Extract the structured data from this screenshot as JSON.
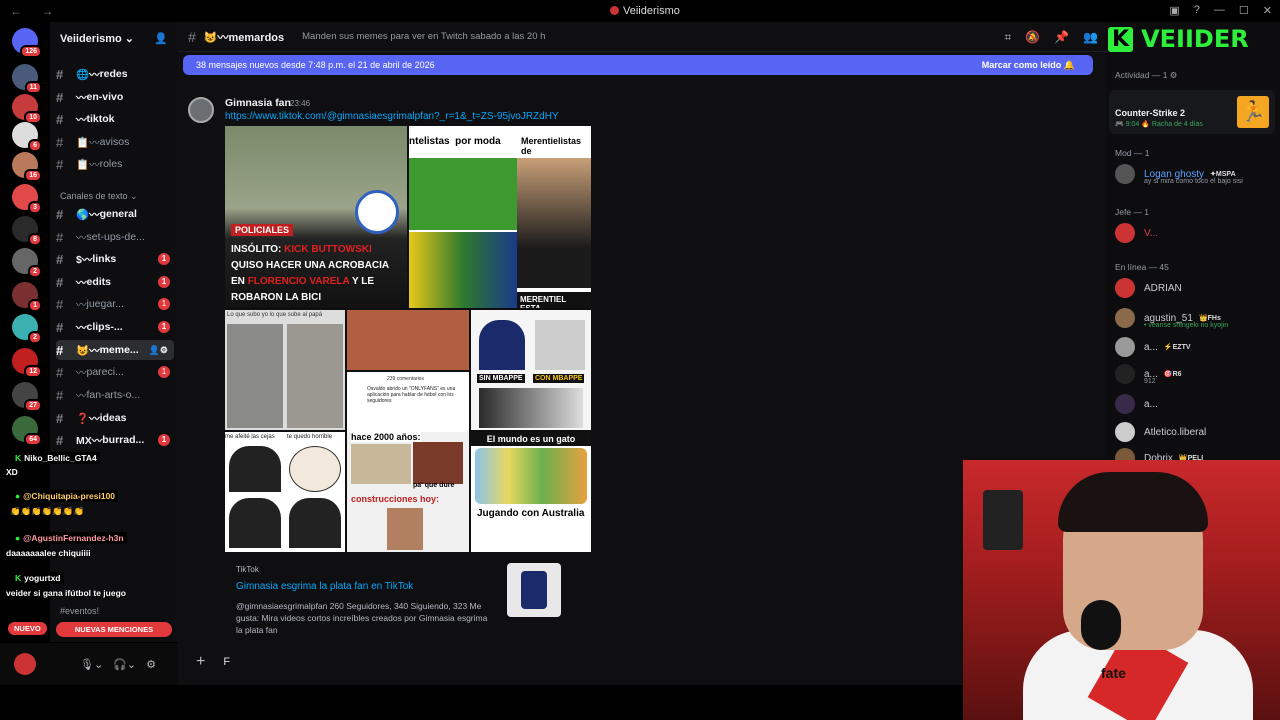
{
  "window": {
    "title": "Veiiderismo",
    "nav": "← →"
  },
  "guild": {
    "name": "Veiiderismo ⌄"
  },
  "channels": [
    {
      "label": "redes",
      "prefix": "🌐〰",
      "state": "bright",
      "top": 0,
      "mention": ""
    },
    {
      "label": "en-vivo",
      "prefix": "〰",
      "state": "bright",
      "mention": ""
    },
    {
      "label": "tiktok",
      "prefix": "〰",
      "state": "bright",
      "mention": ""
    },
    {
      "label": "avisos",
      "prefix": "📋〰",
      "state": "dim",
      "mention": ""
    },
    {
      "label": "roles",
      "prefix": "📋〰",
      "state": "dim",
      "mention": ""
    }
  ],
  "category_text": "Canales de texto ⌄",
  "channels2": [
    {
      "label": "general",
      "prefix": "🌎〰",
      "state": "bright",
      "mention": ""
    },
    {
      "label": "set-ups-de...",
      "prefix": "〰",
      "state": "dim",
      "mention": ""
    },
    {
      "label": "links",
      "prefix": "$〰",
      "state": "bright",
      "mention": "1"
    },
    {
      "label": "edits",
      "prefix": "〰",
      "state": "bright",
      "mention": "1"
    },
    {
      "label": "juegar...",
      "prefix": "〰",
      "state": "dim",
      "mention": "1"
    },
    {
      "label": "clips-...",
      "prefix": "〰",
      "state": "bright",
      "mention": "1"
    },
    {
      "label": "memе...",
      "prefix": "😺〰",
      "state": "active",
      "mention": ""
    },
    {
      "label": "pareci...",
      "prefix": "〰",
      "state": "dim",
      "mention": "1"
    },
    {
      "label": "fan-arts-o...",
      "prefix": "〰",
      "state": "dim",
      "mention": ""
    },
    {
      "label": "ideas",
      "prefix": "❓〰",
      "state": "bright",
      "mention": ""
    },
    {
      "label": "burrad...",
      "prefix": "MX〰",
      "state": "bright",
      "mention": "1"
    }
  ],
  "events_cat": "#eventos!",
  "nuevo": "NUEVO",
  "nuevas": "NUEVAS MENCIONES",
  "server_badges": [
    "126",
    "11",
    "10",
    "6",
    "16",
    "3",
    "8",
    "2",
    "1",
    "2",
    "12",
    "27",
    "64"
  ],
  "header": {
    "name": "😺〰memardos",
    "topic": "Manden sus memes para ver en Twitch sabado a las 20 h"
  },
  "newbar": {
    "text": "38 mensajes nuevos desde 7:48 p.m. el 21 de abril de 2026",
    "action": "Marcar como leído"
  },
  "message": {
    "user": "Gimnasia fan",
    "time": "23:46",
    "link": "https://www.tiktok.com/@gimnasiaesgrimalpfan?_r=1&_t=ZS-95jvoJRZdHY"
  },
  "memes": {
    "m1_tag": "POLICIALES",
    "m1_l1": "INSÓLITO:",
    "m1_l1b": "KICK BUTTOWSKI",
    "m1_l2": "QUISO HACER UNA ACROBACIA",
    "m1_l3a": "EN",
    "m1_l3b": "FLORENCIO VARELA",
    "m1_l3c": "Y LE",
    "m1_l4": "ROBARON LA BICI",
    "m2_top": "ntelistas",
    "m2_top2": "por moda",
    "m3_top": "Merentielistas",
    "m3_top2": "de",
    "m3_bottom": "MERENTIEL ESTA",
    "m4_top": "Lo que subo yo     lo que sube al papá",
    "m6_text": "Osvaldo abrido un \"ONLYFANS\" es una aplicación para hablar de futbol con los seguidores",
    "m6_head": "239 comentarios",
    "m7_l": "SIN MBAPPE",
    "m7_r": "CON MBAPPE",
    "m8_top": "me afeité las cejas",
    "m8_top2": "te quedo horrible",
    "m9_top": "hace 2000 años:",
    "m9_mid": "pa' que dure",
    "m9_bot": "construcciones hoy:",
    "m10_top": "El mundo es un gato",
    "m10_bot": "Jugando con Australia"
  },
  "embed": {
    "source": "TikTok",
    "title": "Gimnasia esgrima la plata fan en TikTok",
    "desc": "@gimnasiaesgrimalpfan 260 Seguidores, 340 Siguiendo, 323 Me gusta: Mira videos cortos increíbles creados por Gimnasia esgrima la plata fan"
  },
  "composer": {
    "text": "F"
  },
  "logo": {
    "k": "K",
    "text": "VEIIDER"
  },
  "members": {
    "activity": "Actividad — 1 ⚙",
    "game": "Counter-Strike 2",
    "game_meta": "🎮 9:04  🔥 Racha de 4 días",
    "mod": "Mod — 1",
    "mod_name": "Logan ghosty",
    "mod_tag": "✦MSPA",
    "mod_sub": "ay si mira como toco el bajo sisi",
    "jefe": "Jefe — 1",
    "jefe_name": "V...",
    "online": "En línea — 45",
    "list": [
      {
        "name": "ADRIAN",
        "tag": "",
        "sub": ""
      },
      {
        "name": "agustin_51",
        "tag": "👑FHs",
        "sub": "• veanse shingeki no kyojin"
      },
      {
        "name": "a...",
        "tag": "⚡EZTV",
        "sub": ""
      },
      {
        "name": "a...",
        "tag": "🎯R6",
        "sub": "912"
      },
      {
        "name": "a...",
        "tag": "",
        "sub": ""
      },
      {
        "name": "Atletico.liberal",
        "tag": "",
        "sub": ""
      },
      {
        "name": "Dobrix",
        "tag": "👑PELI",
        "sub": ""
      }
    ]
  },
  "chat": [
    {
      "name": "Niko_Bellic_GTA4",
      "text": "XD"
    },
    {
      "name": "@Chiquitapia-presi100",
      "text": "👏👏👏👏👏👏👏"
    },
    {
      "name": "@AgustinFernandez-h3n",
      "text": "daaaaaaalee chiquiiii"
    },
    {
      "name": "yogurtxd",
      "text": "veider si gana ifútbol te juego"
    }
  ],
  "webcam": {
    "sponsor": "fate"
  },
  "colors": {
    "accent": "#5865f2",
    "mention": "#e2393d",
    "brand": "#2cf03b",
    "link": "#00a8fc"
  }
}
